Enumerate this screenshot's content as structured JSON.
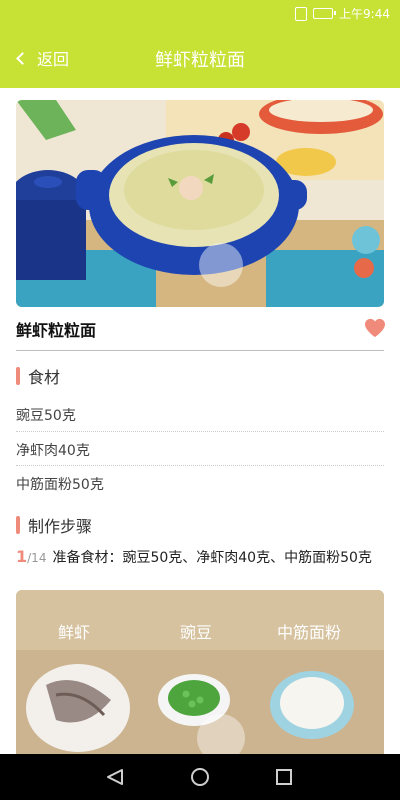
{
  "status": {
    "time": "上午9:44"
  },
  "nav": {
    "back_label": "返回",
    "title": "鲜虾粒粒面"
  },
  "recipe": {
    "name": "鲜虾粒粒面"
  },
  "ingredients_section": {
    "title": "食材",
    "items": [
      "豌豆50克",
      "净虾肉40克",
      "中筋面粉50克"
    ]
  },
  "steps_section": {
    "title": "制作步骤",
    "current_step": "1",
    "total_steps": "/14",
    "step_text": "准备食材：豌豆50克、净虾肉40克、中筋面粉50克",
    "image_labels": [
      "鲜虾",
      "豌豆",
      "中筋面粉"
    ]
  },
  "colors": {
    "accent": "#c8e135",
    "highlight": "#f08a7a"
  }
}
